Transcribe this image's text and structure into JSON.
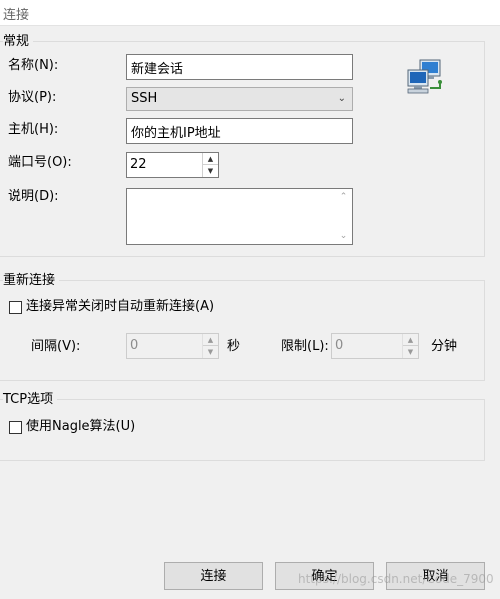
{
  "window": {
    "title": "连接"
  },
  "general": {
    "title": "常规",
    "name_label": "名称(N):",
    "name_value": "新建会话",
    "protocol_label": "协议(P):",
    "protocol_value": "SSH",
    "host_label": "主机(H):",
    "host_value": "你的主机IP地址",
    "port_label": "端口号(O):",
    "port_value": "22",
    "desc_label": "说明(D):",
    "desc_value": "",
    "icon": "network-computers-icon"
  },
  "reconnect": {
    "title": "重新连接",
    "auto_label": "连接异常关闭时自动重新连接(A)",
    "auto_checked": false,
    "interval_label": "间隔(V):",
    "interval_value": "0",
    "interval_unit": "秒",
    "limit_label": "限制(L):",
    "limit_value": "0",
    "limit_unit": "分钟"
  },
  "tcp": {
    "title": "TCP选项",
    "nagle_label": "使用Nagle算法(U)",
    "nagle_checked": false
  },
  "buttons": {
    "connect": "连接",
    "ok": "确定",
    "cancel": "取消"
  },
  "watermark": "https://blog.csdn.net/Code_7900"
}
